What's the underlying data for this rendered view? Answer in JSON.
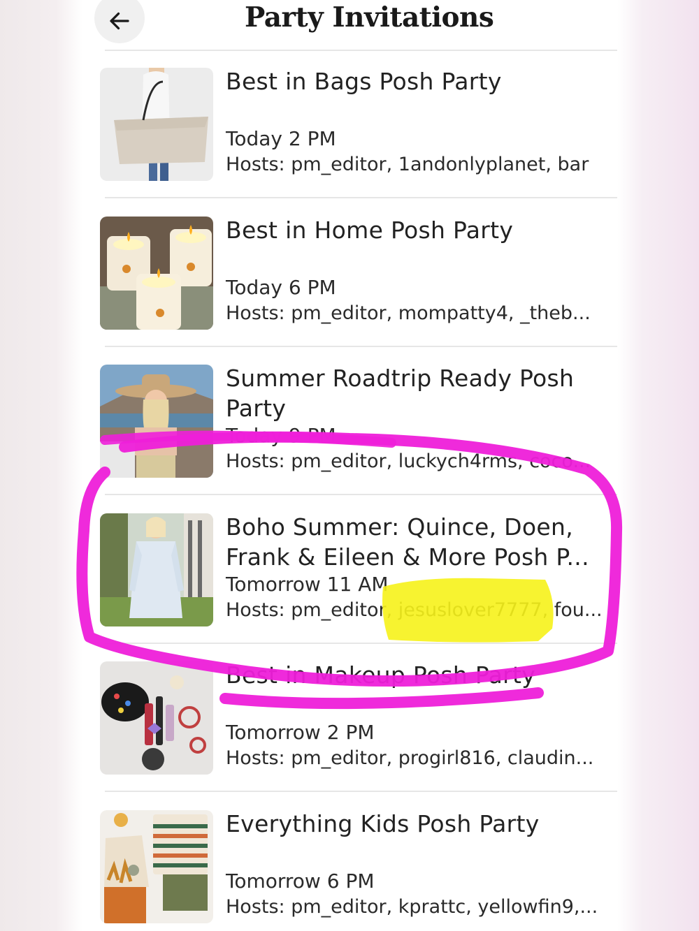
{
  "header": {
    "title": "Party Invitations",
    "back_icon": "arrow-left-icon"
  },
  "parties": [
    {
      "title": "Best in Bags Posh Party",
      "time": "Today 2 PM",
      "hosts": "Hosts: pm_editor, 1andonlyplanet, bar"
    },
    {
      "title": "Best in Home Posh Party",
      "time": "Today 6 PM",
      "hosts": "Hosts: pm_editor, mompatty4, _theb..."
    },
    {
      "title": "Summer Roadtrip Ready Posh Party",
      "time": "Today 9 PM",
      "hosts": "Hosts: pm_editor, luckych4rms, coco..."
    },
    {
      "title": "Boho Summer: Quince, Doen, Frank & Eileen & More Posh P...",
      "time": "Tomorrow 11 AM",
      "hosts": "Hosts: pm_editor, jesuslover7777, fou..."
    },
    {
      "title": "Best in Makeup Posh Party",
      "time": "Tomorrow 2 PM",
      "hosts": "Hosts: pm_editor, progirl816, claudin..."
    },
    {
      "title": "Everything Kids Posh Party",
      "time": "Tomorrow 6 PM",
      "hosts": "Hosts: pm_editor, kprattc, yellowfin9,..."
    }
  ],
  "colors": {
    "highlight_pink": "#ee1fd9",
    "highlight_yellow": "#f6f21a"
  }
}
